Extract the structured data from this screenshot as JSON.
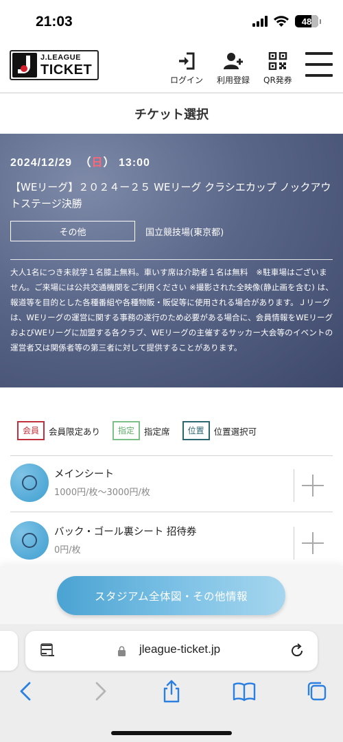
{
  "status_bar": {
    "time": "21:03",
    "battery": "48"
  },
  "header": {
    "logo_top": "J.LEAGUE",
    "logo_bottom": "TICKET",
    "login_label": "ログイン",
    "register_label": "利用登録",
    "qr_label": "QR発券"
  },
  "page_title": "チケット選択",
  "event": {
    "date": "2024/12/29",
    "day_open": "（",
    "day_of_week": "日",
    "day_close": "）",
    "time": "13:00",
    "title": "【WEリーグ】２０２４ー２５ WEリーグ クラシエカップ ノックアウトステージ決勝",
    "category": "その他",
    "venue": "国立競技場(東京都)",
    "notes": "大人1名につき未就学１名膝上無料。車いす席は介助者１名は無料　※駐車場はございません。ご来場には公共交通機関をご利用ください ※撮影された全映像(静止画を含む) は、報道等を目的とした各種番組や各種物販・販促等に使用される場合があります。Ｊリーグは、WEリーグの運営に関する事務の遂行のため必要がある場合に、会員情報をWEリーグおよびWEリーグに加盟する各クラブ、WEリーグの主催するサッカー大会等のイベントの運営者又は関係者等の第三者に対して提供することがあります。"
  },
  "legend": [
    {
      "badge": "会員",
      "text": "会員限定あり"
    },
    {
      "badge": "指定",
      "text": "指定席"
    },
    {
      "badge": "位置",
      "text": "位置選択可"
    }
  ],
  "seats": [
    {
      "name": "メインシート",
      "price": "1000円/枚〜3000円/枚"
    },
    {
      "name": "バック・ゴール裏シート 招待券",
      "price": "0円/枚"
    }
  ],
  "stadium_button": "スタジアム全体図・その他情報",
  "browser": {
    "url": "jleague-ticket.jp"
  }
}
